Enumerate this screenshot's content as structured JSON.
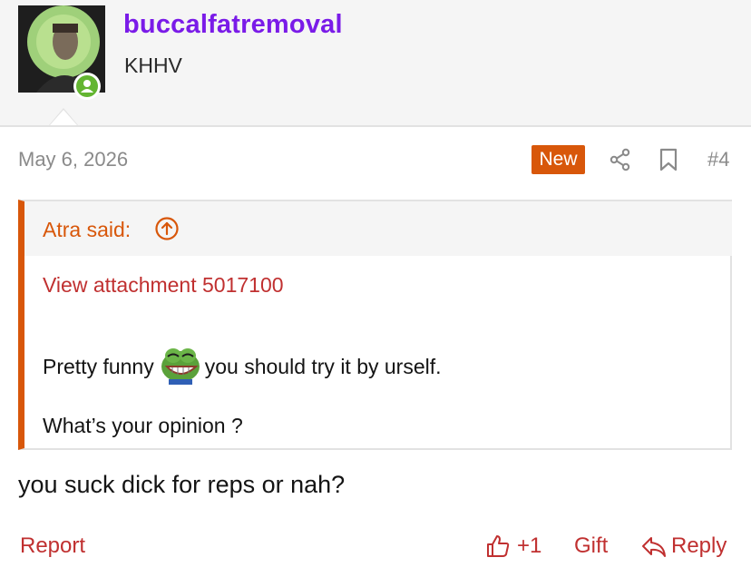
{
  "user": {
    "username": "buccalfatremoval",
    "title": "KHHV",
    "avatar_icon": "avatar-photo",
    "status_icon": "online-status-icon"
  },
  "post": {
    "date": "May 6, 2026",
    "new_badge": "New",
    "number": "#4",
    "body": "you suck dick for reps or nah?"
  },
  "quote": {
    "author": "Atra said:",
    "attachment_link": "View attachment 5017100",
    "line1_before": "Pretty funny",
    "emoji": "pepe-laugh-emoji",
    "line1_after": "you should try it by urself.",
    "line2": "What’s your opinion ?"
  },
  "actions": {
    "report": "Report",
    "like_count": "+1",
    "gift": "Gift",
    "reply": "Reply"
  },
  "colors": {
    "username": "#7a1be8",
    "accent_orange": "#d8570a",
    "link_red": "#c03030",
    "online_green": "#63b531"
  }
}
